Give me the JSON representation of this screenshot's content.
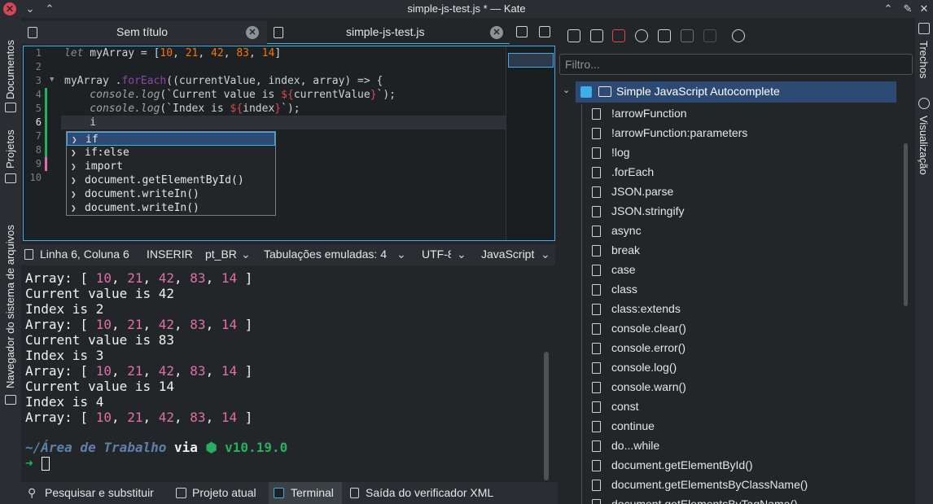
{
  "window": {
    "title": "simple-js-test.js * — Kate"
  },
  "colors": {
    "accent": "#3daee9",
    "close": "#da4453",
    "background": "#232629",
    "numbers": "#e06fa8",
    "prompt_green": "#27ae60"
  },
  "left_sidebar": {
    "tabs": [
      "Documentos",
      "Projetos",
      "Navegador do sistema de arquivos"
    ]
  },
  "right_sidebar": {
    "tabs": [
      "Trechos",
      "Visualização"
    ]
  },
  "tabs": [
    {
      "label": "Sem título",
      "icon": "file-icon"
    },
    {
      "label": "simple-js-test.js",
      "icon": "file-icon"
    }
  ],
  "editor": {
    "line_numbers": [
      "1",
      "2",
      "3",
      "4",
      "5",
      "6",
      "7",
      "8",
      "9",
      "10"
    ],
    "current_line": "6",
    "lines": {
      "l1_kw": "let",
      "l1_a": " myArray = [",
      "l1_n1": "10",
      "l1_n2": "21",
      "l1_n3": "42",
      "l1_n4": "83",
      "l1_n5": "14",
      "l1_end": "]",
      "l3_a": "myArray .",
      "l3_fn": "forEach",
      "l3_b": "((currentValue, index, array) => {",
      "l4_a": "    console.log",
      "l4_b": "(`Current value is ",
      "l4_t": "${",
      "l4_c": "currentValue",
      "l4_t2": "}",
      "l4_d": "`);",
      "l5_a": "    console.log",
      "l5_b": "(`Index is ",
      "l5_t": "${",
      "l5_c": "index",
      "l5_t2": "}",
      "l5_d": "`);",
      "l6": "    i"
    }
  },
  "completion": {
    "items": [
      "if",
      "if:else",
      "import",
      "document.getElementById()",
      "document.writeIn()",
      "document.writeIn()"
    ],
    "selected": "if"
  },
  "statusbar": {
    "position": "Linha 6, Coluna 6",
    "mode": "INSERIR",
    "language_dict": "pt_BR",
    "indent": "Tabulações emuladas: 4",
    "encoding": "UTF-8",
    "syntax": "JavaScript"
  },
  "terminal": {
    "lines": [
      {
        "a": "Array: [ ",
        "nums": [
          "10",
          "21",
          "42",
          "83",
          "14"
        ],
        "b": " ]"
      },
      {
        "text": "Current value is 42"
      },
      {
        "text": "Index is 2"
      },
      {
        "a": "Array: [ ",
        "nums": [
          "10",
          "21",
          "42",
          "83",
          "14"
        ],
        "b": " ]"
      },
      {
        "text": "Current value is 83"
      },
      {
        "text": "Index is 3"
      },
      {
        "a": "Array: [ ",
        "nums": [
          "10",
          "21",
          "42",
          "83",
          "14"
        ],
        "b": " ]"
      },
      {
        "text": "Current value is 14"
      },
      {
        "text": "Index is 4"
      },
      {
        "a": "Array: [ ",
        "nums": [
          "10",
          "21",
          "42",
          "83",
          "14"
        ],
        "b": " ]"
      }
    ],
    "prompt_path": "~/Área de Trabalho",
    "prompt_via": " via ",
    "prompt_node": "⬢ v10.19.0",
    "prompt_arrow": "➜"
  },
  "bottombar": {
    "items": [
      "Pesquisar e substituir",
      "Projeto atual",
      "Terminal",
      "Saída do verificador XML"
    ],
    "active": "Terminal"
  },
  "snippets": {
    "filter_placeholder": "Filtro...",
    "repository": "Simple JavaScript Autocomplete",
    "items": [
      "!arrowFunction",
      "!arrowFunction:parameters",
      "!log",
      ".forEach",
      "JSON.parse",
      "JSON.stringify",
      "async",
      "break",
      "case",
      "class",
      "class:extends",
      "console.clear()",
      "console.error()",
      "console.log()",
      "console.warn()",
      "const",
      "continue",
      "do...while",
      "document.getElementById()",
      "document.getElementsByClassName()",
      "document.getElementsByTagName()"
    ]
  }
}
